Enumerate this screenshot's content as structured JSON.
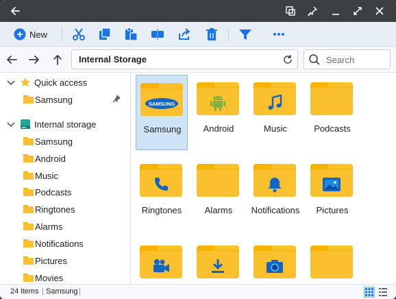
{
  "titlebar": {
    "back_icon": "arrow-left-icon",
    "controls": [
      "select-window-icon",
      "pin-icon",
      "minimize-icon",
      "maximize-icon",
      "close-icon"
    ]
  },
  "toolbar": {
    "new_label": "New",
    "icons": [
      "cut-icon",
      "copy-icon",
      "paste-icon",
      "rename-icon",
      "share-icon",
      "delete-icon",
      "filter-icon",
      "more-icon"
    ],
    "accent": "#1a73e8"
  },
  "address": {
    "path": "Internal Storage",
    "search_placeholder": "Search"
  },
  "sidebar": {
    "quick_access": {
      "label": "Quick access",
      "items": [
        {
          "label": "Samsung",
          "pinned": true
        }
      ]
    },
    "internal_storage": {
      "label": "Internal storage",
      "items": [
        "Samsung",
        "Android",
        "Music",
        "Podcasts",
        "Ringtones",
        "Alarms",
        "Notifications",
        "Pictures",
        "Movies"
      ]
    }
  },
  "grid": {
    "items": [
      {
        "label": "Samsung",
        "icon": "samsung-logo",
        "selected": true
      },
      {
        "label": "Android",
        "icon": "android-icon"
      },
      {
        "label": "Music",
        "icon": "music-note-icon"
      },
      {
        "label": "Podcasts",
        "icon": ""
      },
      {
        "label": "Ringtones",
        "icon": "phone-icon"
      },
      {
        "label": "Alarms",
        "icon": ""
      },
      {
        "label": "Notifications",
        "icon": "bell-icon"
      },
      {
        "label": "Pictures",
        "icon": "image-icon"
      },
      {
        "label": "",
        "icon": "video-camera-icon"
      },
      {
        "label": "",
        "icon": "download-icon"
      },
      {
        "label": "",
        "icon": "camera-icon"
      },
      {
        "label": "",
        "icon": ""
      }
    ],
    "emblem_text": "SAMSUNG"
  },
  "status": {
    "count": "24 items",
    "selection": "Samsung"
  },
  "colors": {
    "folder": "#fbc02d",
    "folder_back": "#f6b400",
    "selection": "#cfe3f7",
    "emblem_blue": "#1565c0",
    "android_green": "#7cb342"
  }
}
